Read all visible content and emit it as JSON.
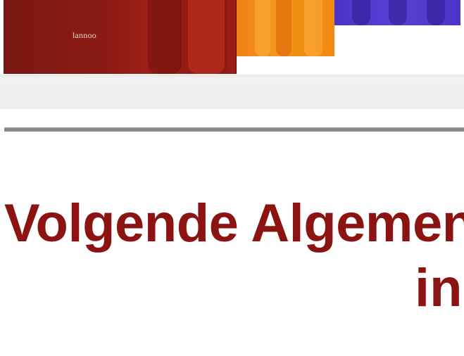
{
  "hero_image": {
    "publisher_logo_text": "lannoo",
    "colors": {
      "red_book": "#8c1a14",
      "orange_book": "#f39419",
      "blue_book": "#5a3fd4"
    }
  },
  "heading": {
    "line1": "Volgende Algemen",
    "line2": "in",
    "color": "#8b1412"
  }
}
